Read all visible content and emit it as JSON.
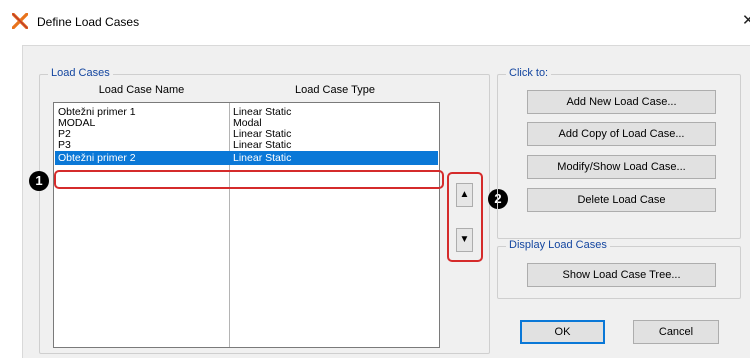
{
  "window": {
    "title": "Define Load Cases",
    "icon": "etabs-x-icon",
    "close_glyph": "✕"
  },
  "load_cases_group": {
    "title": "Load Cases",
    "columns": [
      "Load Case Name",
      "Load Case Type"
    ],
    "rows": [
      {
        "name": "Obtežni primer 1",
        "type": "Linear Static"
      },
      {
        "name": "MODAL",
        "type": "Modal"
      },
      {
        "name": "P2",
        "type": "Linear Static"
      },
      {
        "name": "P3",
        "type": "Linear Static"
      },
      {
        "name": "Obtežni primer 2",
        "type": "Linear Static",
        "selected": true
      }
    ]
  },
  "move_buttons": {
    "up": "▲",
    "down": "▼"
  },
  "click_to_group": {
    "title": "Click to:",
    "buttons": [
      "Add New Load Case...",
      "Add Copy of Load Case...",
      "Modify/Show Load Case...",
      "Delete Load Case"
    ]
  },
  "display_group": {
    "title": "Display Load Cases",
    "button": "Show Load Case Tree..."
  },
  "footer": {
    "ok": "OK",
    "cancel": "Cancel"
  },
  "annotations": {
    "badge_1": "1",
    "badge_2": "2",
    "highlight_color": "#d52b2b"
  },
  "colors": {
    "selection": "#0a78d7",
    "group_title": "#1446a0"
  }
}
